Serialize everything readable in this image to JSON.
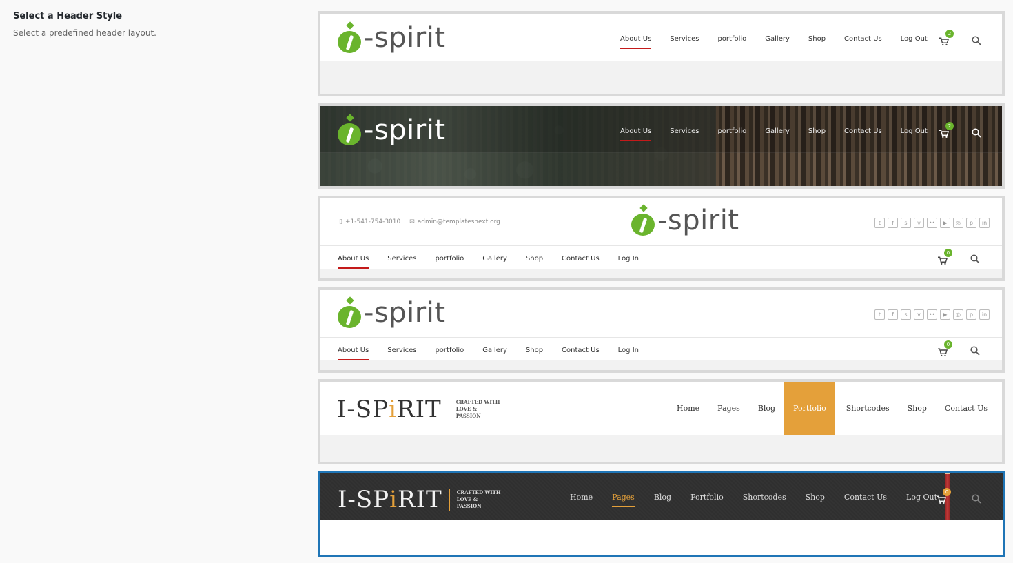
{
  "field": {
    "title": "Select a Header Style",
    "description": "Select a predefined header layout."
  },
  "logos": {
    "spirit_text": "-spirit",
    "serif_main_before": "I-SP",
    "serif_main_accent": "i",
    "serif_main_after": "RIT",
    "tagline_line1": "CRAFTED WITH",
    "tagline_line2": "LOVE &",
    "tagline_line3": "PASSION"
  },
  "header1": {
    "nav": [
      "About Us",
      "Services",
      "portfolio",
      "Gallery",
      "Shop",
      "Contact Us",
      "Log Out"
    ],
    "cart_count": "2"
  },
  "header2": {
    "nav": [
      "About Us",
      "Services",
      "portfolio",
      "Gallery",
      "Shop",
      "Contact Us",
      "Log Out"
    ],
    "cart_count": "2"
  },
  "header3": {
    "phone": "+1-541-754-3010",
    "email": "admin@templatesnext.org",
    "nav": [
      "About Us",
      "Services",
      "portfolio",
      "Gallery",
      "Shop",
      "Contact Us",
      "Log In"
    ],
    "cart_count": "0"
  },
  "header4": {
    "nav": [
      "About Us",
      "Services",
      "portfolio",
      "Gallery",
      "Shop",
      "Contact Us",
      "Log In"
    ],
    "cart_count": "0"
  },
  "header5": {
    "nav": [
      "Home",
      "Pages",
      "Blog",
      "Portfolio",
      "Shortcodes",
      "Shop",
      "Contact Us"
    ]
  },
  "header6": {
    "nav": [
      "Home",
      "Pages",
      "Blog",
      "Portfolio",
      "Shortcodes",
      "Shop",
      "Contact Us",
      "Log Out"
    ],
    "cart_count": "0"
  },
  "social_icons": [
    "twitter-icon",
    "facebook-icon",
    "skype-icon",
    "vine-icon",
    "flickr-icon",
    "youtube-icon",
    "instagram-icon",
    "pinterest-icon",
    "linkedin-icon"
  ],
  "colors": {
    "green": "#6ab42d",
    "red_active": "#c41a1a",
    "gold": "#e4a03a",
    "selected_border": "#1f75b6"
  },
  "selected_option": 6
}
